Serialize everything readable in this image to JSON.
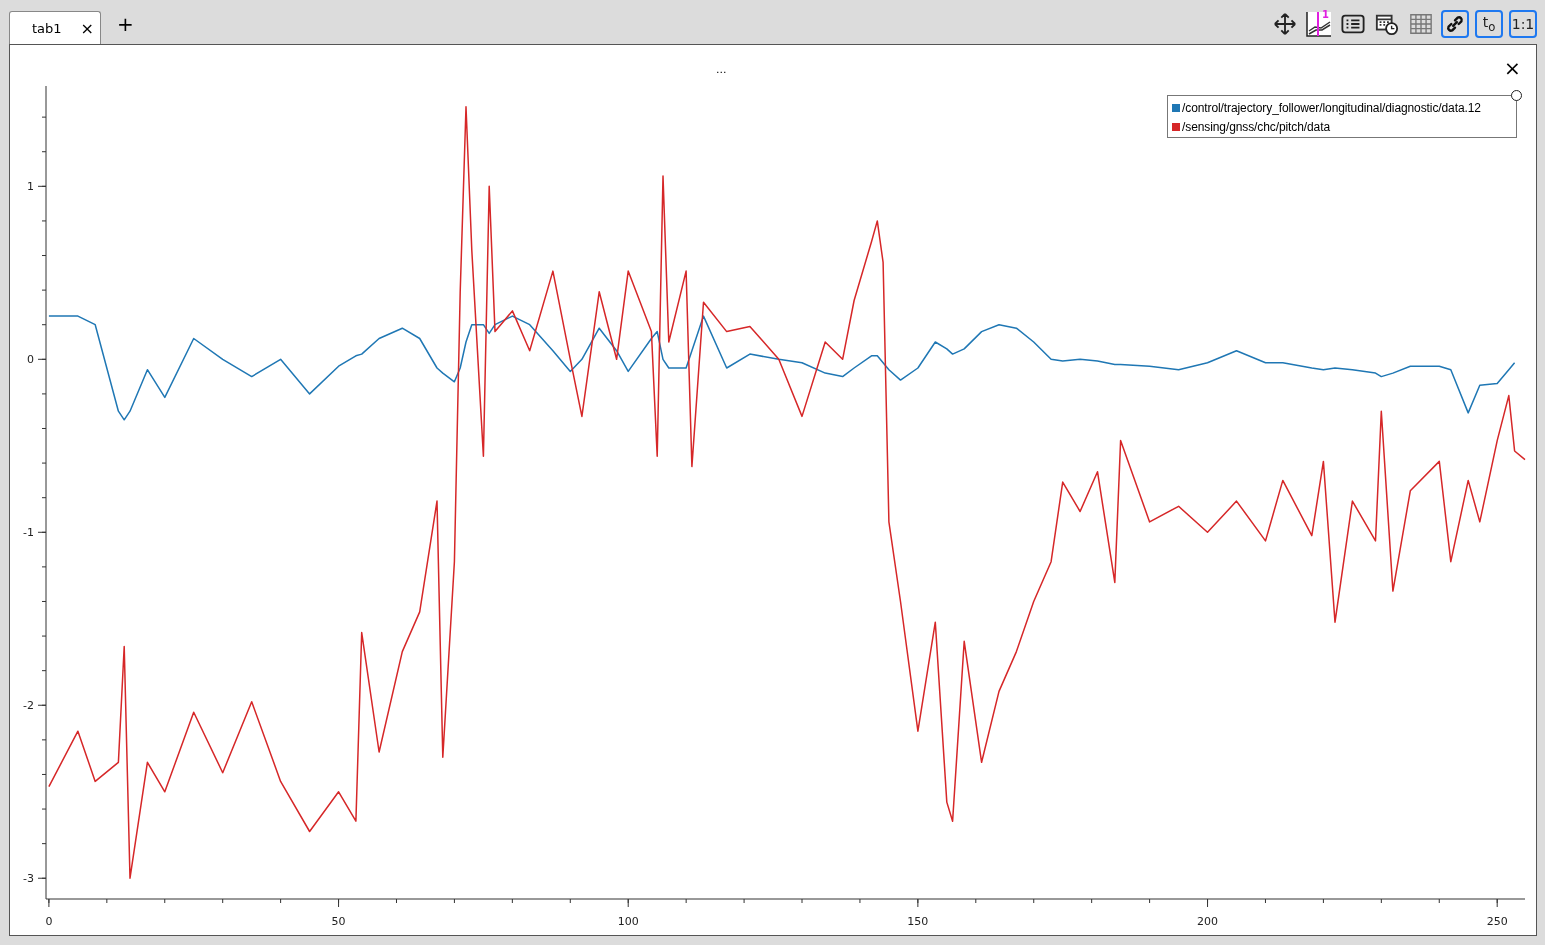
{
  "tabs": [
    {
      "label": "tab1",
      "selected": true,
      "close": "×"
    }
  ],
  "add_tab": "+",
  "toolbar": [
    {
      "kind": "move",
      "on": false
    },
    {
      "kind": "marker",
      "on": false,
      "label": "1"
    },
    {
      "kind": "list",
      "on": false
    },
    {
      "kind": "calendar",
      "on": false
    },
    {
      "kind": "grid",
      "on": false
    },
    {
      "kind": "link",
      "on": true
    },
    {
      "kind": "text",
      "on": true,
      "label": "t$_{o}$"
    },
    {
      "kind": "text",
      "on": true,
      "label": "1:1"
    }
  ],
  "plot": {
    "title": "...",
    "close": "×",
    "chart_data": {
      "type": "line",
      "xlim": [
        -0.5,
        254.8
      ],
      "ylim": [
        -3.12,
        1.58
      ],
      "xticks": [
        0,
        50,
        100,
        150,
        200,
        250
      ],
      "yticks": [
        -3,
        -2,
        -1,
        0,
        1
      ],
      "x": [
        0,
        5,
        8,
        12,
        13,
        14,
        17,
        20,
        25,
        30,
        35,
        40,
        45,
        50,
        53,
        54,
        57,
        61,
        64,
        67,
        68,
        70,
        71,
        72,
        73,
        75,
        76,
        77,
        80,
        83,
        87,
        90,
        92,
        95,
        98,
        100,
        104,
        105,
        106,
        107,
        110,
        111,
        113,
        117,
        121,
        126,
        130,
        134,
        137,
        139,
        142,
        143,
        144,
        145,
        147,
        150,
        153,
        155,
        156,
        158,
        161,
        164,
        167,
        170,
        173,
        175,
        178,
        181,
        184,
        185,
        190,
        195,
        200,
        205,
        210,
        213,
        218,
        220,
        222,
        225,
        229,
        230,
        232,
        235,
        240,
        242,
        245,
        247,
        250,
        252,
        253,
        254.8
      ],
      "series": [
        {
          "name": "/control/trajectory_follower/longitudinal/diagnostic/data.12",
          "color": "#1f77b4",
          "values": [
            0.25,
            0.25,
            0.2,
            -0.3,
            -0.35,
            -0.3,
            -0.06,
            -0.22,
            0.12,
            0.0,
            -0.1,
            0,
            -0.2,
            -0.04,
            0.02,
            0.03,
            0.12,
            0.18,
            0.12,
            -0.05,
            -0.08,
            -0.13,
            -0.05,
            0.1,
            0.2,
            0.2,
            0.15,
            0.2,
            0.25,
            0.2,
            0.05,
            -0.07,
            0.0,
            0.18,
            0.05,
            -0.07,
            0.12,
            0.16,
            0.0,
            -0.05,
            -0.05,
            0.05,
            0.25,
            -0.05,
            0.03,
            0.0,
            -0.02,
            -0.08,
            -0.1,
            -0.05,
            0.02,
            0.02,
            -0.02,
            -0.06,
            -0.12,
            -0.05,
            0.1,
            0.06,
            0.03,
            0.06,
            0.16,
            0.2,
            0.18,
            0.1,
            0.0,
            -0.01,
            0.0,
            -0.01,
            -0.03,
            -0.03,
            -0.04,
            -0.06,
            -0.02,
            0.05,
            -0.02,
            -0.02,
            -0.05,
            -0.06,
            -0.05,
            -0.06,
            -0.08,
            -0.1,
            -0.08,
            -0.04,
            -0.04,
            -0.06,
            -0.31,
            -0.15,
            -0.14,
            -0.06,
            -0.02,
            null
          ]
        },
        {
          "name": "/sensing/gnss/chc/pitch/data",
          "color": "#d62728",
          "values": [
            -2.47,
            -2.15,
            -2.44,
            -2.33,
            -1.66,
            -3.0,
            -2.33,
            -2.5,
            -2.04,
            -2.39,
            -1.98,
            -2.44,
            -2.73,
            -2.5,
            -2.67,
            -1.58,
            -2.27,
            -1.69,
            -1.46,
            -0.82,
            -2.3,
            -1.17,
            0.39,
            1.46,
            0.63,
            -0.56,
            1.0,
            0.16,
            0.28,
            0.05,
            0.51,
            0.0,
            -0.33,
            0.39,
            0.0,
            0.51,
            0.16,
            -0.56,
            1.06,
            0.1,
            0.51,
            -0.62,
            0.33,
            0.16,
            0.19,
            0.0,
            -0.33,
            0.1,
            0.0,
            0.34,
            0.68,
            0.8,
            0.56,
            -0.94,
            -1.4,
            -2.15,
            -1.52,
            -2.56,
            -2.67,
            -1.63,
            -2.33,
            -1.92,
            -1.69,
            -1.4,
            -1.17,
            -0.71,
            -0.88,
            -0.65,
            -1.29,
            -0.47,
            -0.94,
            -0.85,
            -1.0,
            -0.82,
            -1.05,
            -0.7,
            -1.02,
            -0.59,
            -1.52,
            -0.82,
            -1.05,
            -0.3,
            -1.34,
            -0.76,
            -0.59,
            -1.17,
            -0.7,
            -0.94,
            -0.47,
            -0.21,
            -0.53,
            -0.58
          ]
        }
      ]
    }
  }
}
